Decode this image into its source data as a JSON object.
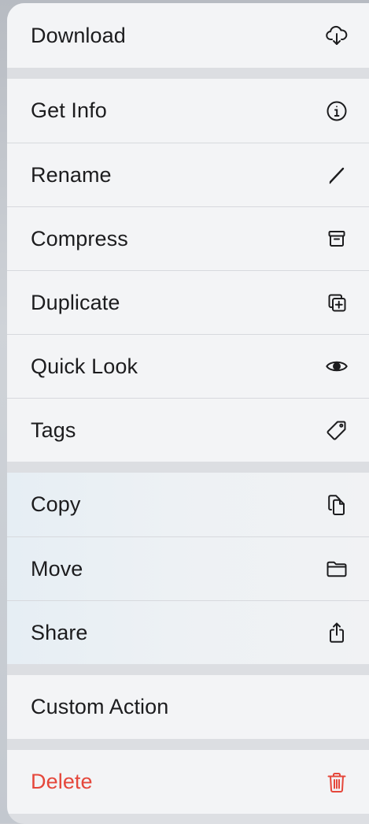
{
  "menu": {
    "download": {
      "label": "Download",
      "icon": "cloud-download-icon"
    },
    "get_info": {
      "label": "Get Info",
      "icon": "info-circle-icon"
    },
    "rename": {
      "label": "Rename",
      "icon": "pencil-icon"
    },
    "compress": {
      "label": "Compress",
      "icon": "archive-box-icon"
    },
    "duplicate": {
      "label": "Duplicate",
      "icon": "duplicate-plus-icon"
    },
    "quick_look": {
      "label": "Quick Look",
      "icon": "eye-icon"
    },
    "tags": {
      "label": "Tags",
      "icon": "tag-icon"
    },
    "copy": {
      "label": "Copy",
      "icon": "copy-documents-icon"
    },
    "move": {
      "label": "Move",
      "icon": "folder-icon"
    },
    "share": {
      "label": "Share",
      "icon": "share-icon"
    },
    "custom_action": {
      "label": "Custom Action"
    },
    "delete": {
      "label": "Delete",
      "icon": "trash-icon",
      "color": "#e5473b"
    }
  }
}
